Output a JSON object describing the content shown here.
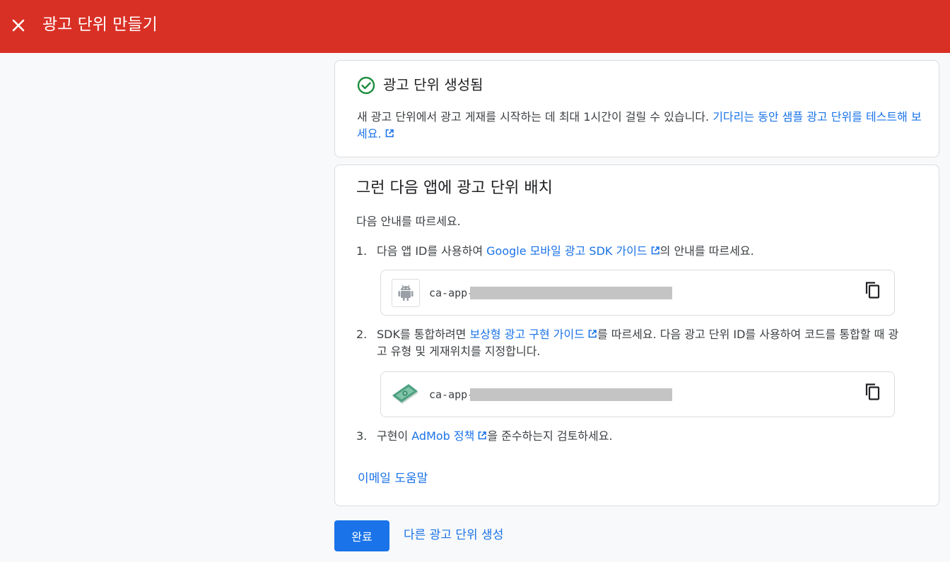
{
  "header": {
    "title": "광고 단위 만들기",
    "close_icon": "close-icon",
    "background_color": "#d93025"
  },
  "created_card": {
    "title": "광고 단위 생성됨",
    "status_icon": "check-circle-icon",
    "message": "새 광고 단위에서 광고 게재를 시작하는 데 최대 1시간이 걸릴 수 있습니다. ",
    "link_text": "기다리는 동안 샘플 광고 단위를 테스트해 보세요."
  },
  "placement_card": {
    "title": "그런 다음 앱에 광고 단위 배치",
    "intro": "다음 안내를 따르세요.",
    "steps": [
      {
        "number": "1.",
        "text_before": "다음 앱 ID를 사용하여 ",
        "link_text": "Google 모바일 광고 SDK 가이드",
        "text_after": "의 안내를 따르세요.",
        "id_value": "ca-app-",
        "icon": "android-icon"
      },
      {
        "number": "2.",
        "text_before": "SDK를 통합하려면 ",
        "link_text": "보상형 광고 구현 가이드",
        "text_after": "를 따르세요. 다음 광고 단위 ID를 사용하여 코드를 통합할 때 광고 유형 및 게재위치를 지정합니다.",
        "id_value": "ca-app-",
        "icon": "rewarded-ad-icon"
      },
      {
        "number": "3.",
        "text_before": "구현이 ",
        "link_text": "AdMob 정책",
        "text_after": "을 준수하는지 검토하세요."
      }
    ],
    "email_help": "이메일 도움말"
  },
  "footer": {
    "done_label": "완료",
    "create_another_label": "다른 광고 단위 생성"
  },
  "colors": {
    "accent": "#1a73e8",
    "success": "#1e8e3e",
    "header": "#d93025"
  }
}
